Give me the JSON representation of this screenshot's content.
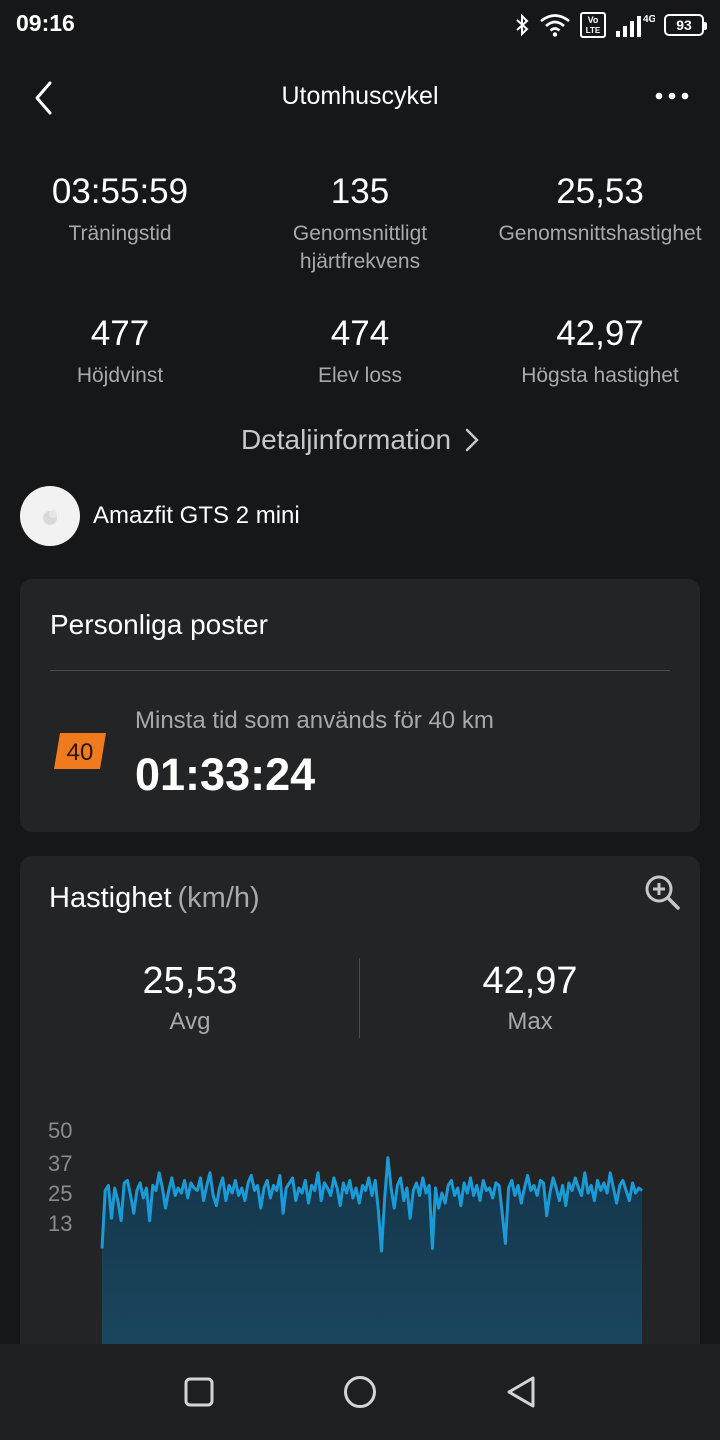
{
  "status_bar": {
    "time": "09:16",
    "network": "4G",
    "volte": "Vo LTE",
    "battery": "93"
  },
  "header": {
    "title": "Utomhuscykel"
  },
  "summary": {
    "stats": [
      {
        "value": "03:55:59",
        "label": "Träningstid"
      },
      {
        "value": "135",
        "label": "Genomsnittligt hjärtfrekvens"
      },
      {
        "value": "25,53",
        "label": "Genomsnittshastighet"
      },
      {
        "value": "477",
        "label": "Höjdvinst"
      },
      {
        "value": "474",
        "label": "Elev loss"
      },
      {
        "value": "42,97",
        "label": "Högsta hastighet"
      }
    ],
    "detail_link": "Detaljinformation"
  },
  "device": {
    "name": "Amazfit GTS 2 mini"
  },
  "records": {
    "title": "Personliga poster",
    "badge": "40",
    "badge_color": "#f07a1e",
    "label": "Minsta tid som används för 40 km",
    "value": "01:33:24"
  },
  "speed": {
    "title": "Hastighet",
    "unit": "(km/h)",
    "avg_value": "25,53",
    "avg_label": "Avg",
    "max_value": "42,97",
    "max_label": "Max"
  },
  "chart_data": {
    "type": "area",
    "title": "",
    "xlabel": "",
    "ylabel": "",
    "y_ticks": [
      "50",
      "37",
      "25",
      "13"
    ],
    "ylim": [
      0,
      50
    ],
    "line_color": "#1a9bd7",
    "fill_color": "#15354a",
    "series": [
      {
        "values": [
          3,
          26,
          28,
          15,
          27,
          22,
          14,
          29,
          30,
          24,
          17,
          26,
          29,
          23,
          27,
          14,
          28,
          26,
          33,
          27,
          19,
          26,
          31,
          24,
          27,
          25,
          30,
          23,
          29,
          27,
          26,
          31,
          22,
          28,
          33,
          24,
          20,
          27,
          31,
          22,
          28,
          25,
          30,
          24,
          27,
          22,
          29,
          32,
          26,
          28,
          19,
          27,
          30,
          23,
          28,
          26,
          32,
          17,
          27,
          29,
          31,
          22,
          27,
          25,
          30,
          21,
          28,
          26,
          33,
          22,
          29,
          27,
          24,
          31,
          27,
          20,
          29,
          25,
          30,
          23,
          27,
          21,
          28,
          26,
          31,
          24,
          30,
          18,
          2,
          23,
          39,
          27,
          19,
          28,
          31,
          22,
          27,
          15,
          26,
          29,
          24,
          31,
          25,
          28,
          3,
          27,
          19,
          25,
          21,
          28,
          30,
          24,
          27,
          20,
          29,
          25,
          31,
          24,
          28,
          22,
          30,
          26,
          27,
          23,
          29,
          28,
          17,
          5,
          27,
          30,
          24,
          28,
          21,
          27,
          32,
          26,
          28,
          24,
          30,
          29,
          16,
          25,
          31,
          27,
          22,
          28,
          20,
          29,
          26,
          31,
          27,
          24,
          33,
          25,
          28,
          22,
          30,
          26,
          29,
          25,
          33,
          27,
          21,
          28,
          30,
          26,
          22,
          29,
          25,
          27,
          26
        ]
      }
    ]
  }
}
